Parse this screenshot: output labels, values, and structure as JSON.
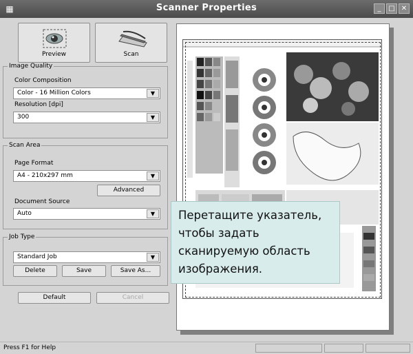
{
  "window": {
    "title": "Scanner Properties"
  },
  "window_buttons": {
    "minimize": "_",
    "maximize": "□",
    "close": "✕"
  },
  "toolbar": {
    "preview_label": "Preview",
    "scan_label": "Scan"
  },
  "image_quality": {
    "legend": "Image Quality",
    "color_label": "Color Composition",
    "color_value": "Color - 16 Million Colors",
    "resolution_label": "Resolution [dpi]",
    "resolution_value": "300"
  },
  "scan_area": {
    "legend": "Scan Area",
    "page_format_label": "Page Format",
    "page_format_value": "A4 - 210x297 mm",
    "advanced_label": "Advanced",
    "source_label": "Document Source",
    "source_value": "Auto"
  },
  "job_type": {
    "legend": "Job Type",
    "value": "Standard Job",
    "delete_label": "Delete",
    "save_label": "Save",
    "save_as_label": "Save As..."
  },
  "footer_buttons": {
    "default_label": "Default",
    "cancel_label": "Cancel"
  },
  "tooltip": {
    "lines": [
      "Перетащите указатель,",
      "чтобы задать",
      "сканируемую область",
      "изображения."
    ]
  },
  "status": {
    "text": "Press F1 for Help"
  }
}
